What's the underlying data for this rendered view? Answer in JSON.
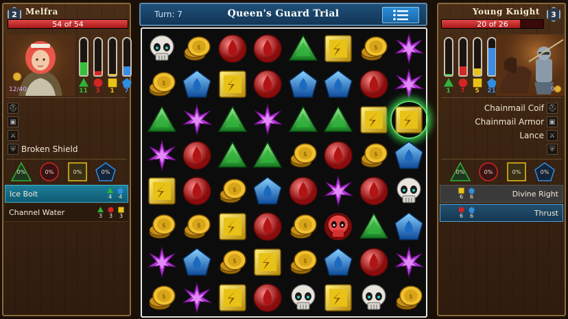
{
  "turn_label": "Turn: 7",
  "title": "Queen's Guard Trial",
  "player": {
    "level": "2",
    "name": "Melfra",
    "hp_text": "54 of 54",
    "hp_fraction": 1.0,
    "gold_text": "12/40",
    "mana": [
      {
        "color": "green",
        "value": "11",
        "fraction": 0.35,
        "hex": "#34c03a"
      },
      {
        "color": "red",
        "value": "3",
        "fraction": 0.12,
        "hex": "#d42828"
      },
      {
        "color": "yellow",
        "value": "1",
        "fraction": 0.04,
        "hex": "#e8c21a"
      },
      {
        "color": "blue",
        "value": "7",
        "fraction": 0.25,
        "hex": "#3a8ee8"
      }
    ],
    "equipment": [
      {
        "label": "",
        "icon": "helmet-icon"
      },
      {
        "label": "",
        "icon": "armor-icon"
      },
      {
        "label": "",
        "icon": "sword-icon"
      },
      {
        "label": "Broken Shield",
        "icon": "shield-icon"
      }
    ],
    "resists": [
      "0%",
      "0%",
      "0%",
      "0%"
    ],
    "spells": [
      {
        "name": "Ice Bolt",
        "costs": [
          {
            "gem": "green",
            "n": "4"
          },
          {
            "gem": "blue",
            "n": "4"
          }
        ]
      },
      {
        "name": "Channel Water",
        "costs": [
          {
            "gem": "green",
            "n": "3"
          },
          {
            "gem": "red",
            "n": "3"
          },
          {
            "gem": "yellow",
            "n": "3"
          }
        ]
      }
    ]
  },
  "enemy": {
    "level": "3",
    "name": "Young Knight",
    "hp_text": "20 of 26",
    "hp_fraction": 0.77,
    "gold_text": "9",
    "mana": [
      {
        "color": "green",
        "value": "1",
        "fraction": 0.04,
        "hex": "#34c03a"
      },
      {
        "color": "red",
        "value": "7",
        "fraction": 0.25,
        "hex": "#d42828"
      },
      {
        "color": "yellow",
        "value": "5",
        "fraction": 0.18,
        "hex": "#e8c21a"
      },
      {
        "color": "blue",
        "value": "21",
        "fraction": 0.75,
        "hex": "#3a8ee8"
      }
    ],
    "equipment": [
      {
        "label": "Chainmail Coif",
        "icon": "helmet-icon"
      },
      {
        "label": "Chainmail Armor",
        "icon": "armor-icon"
      },
      {
        "label": "Lance",
        "icon": "lance-icon"
      },
      {
        "label": "",
        "icon": "shield-icon"
      }
    ],
    "resists": [
      "0%",
      "0%",
      "0%",
      "0%"
    ],
    "spells": [
      {
        "name": "Divine Right",
        "costs": [
          {
            "gem": "yellow",
            "n": "6"
          },
          {
            "gem": "blue",
            "n": "6"
          }
        ]
      },
      {
        "name": "Thrust",
        "costs": [
          {
            "gem": "red",
            "n": "6"
          },
          {
            "gem": "blue",
            "n": "6"
          }
        ]
      }
    ]
  },
  "board": [
    [
      "skull",
      "coin",
      "red",
      "red",
      "green",
      "yellow",
      "coin",
      "purple"
    ],
    [
      "coin",
      "blue",
      "yellow",
      "red",
      "blue",
      "blue",
      "red",
      "purple"
    ],
    [
      "green",
      "purple",
      "green",
      "purple",
      "green",
      "green",
      "yellow",
      "yellow"
    ],
    [
      "purple",
      "red",
      "green",
      "green",
      "coin",
      "red",
      "coin",
      "blue"
    ],
    [
      "yellow",
      "red",
      "coin",
      "blue",
      "red",
      "purple",
      "red",
      "skull"
    ],
    [
      "coin",
      "coin",
      "yellow",
      "red",
      "coin",
      "redskull",
      "green",
      "blue"
    ],
    [
      "purple",
      "blue",
      "coin",
      "yellow",
      "coin",
      "blue",
      "red",
      "purple"
    ],
    [
      "coin",
      "purple",
      "yellow",
      "red",
      "skull",
      "yellow",
      "skull",
      "coin"
    ]
  ],
  "highlighted_cell": {
    "row": 2,
    "col": 7
  },
  "colors": {
    "green": "#2fb43a",
    "red": "#d42424",
    "yellow": "#e8c216",
    "blue": "#2f8de0",
    "purple": "#b03ad0"
  }
}
